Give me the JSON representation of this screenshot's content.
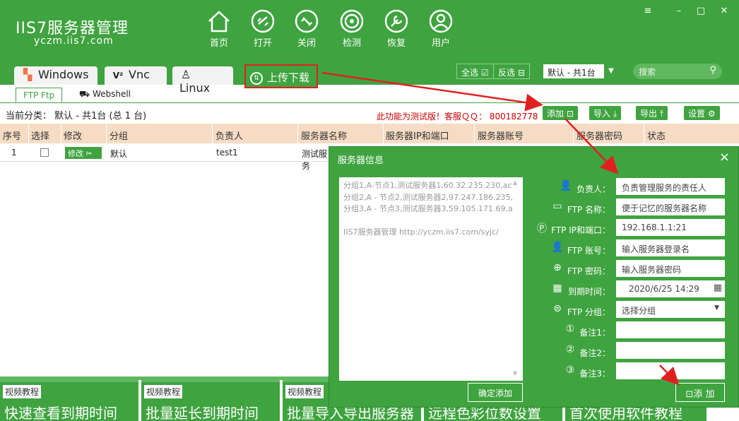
{
  "app": {
    "title": "IIS7服务器管理",
    "url": "yczm.iis7.com"
  },
  "nav": [
    {
      "label": "首页",
      "icon": "home-icon"
    },
    {
      "label": "打开",
      "icon": "link-icon"
    },
    {
      "label": "关闭",
      "icon": "unlink-icon"
    },
    {
      "label": "检测",
      "icon": "target-icon"
    },
    {
      "label": "恢复",
      "icon": "wrench-icon"
    },
    {
      "label": "用户",
      "icon": "user-icon"
    }
  ],
  "window_controls": {
    "menu": "≡",
    "minimize": "–",
    "maximize": "□",
    "close": "✕"
  },
  "tabs": [
    {
      "label": "Windows",
      "icon": "windows-icon"
    },
    {
      "label": "Vnc",
      "icon": "vnc-icon"
    },
    {
      "label": "Linux",
      "icon": "linux-icon"
    },
    {
      "label": "上传下载",
      "icon": "upload-download-icon"
    }
  ],
  "toolbar": {
    "select_all": "全选",
    "invert": "反选",
    "group_value": "默认 - 共1台",
    "search_placeholder": "搜索"
  },
  "subtabs": [
    {
      "label": "FTP  Ftp"
    },
    {
      "label": "Webshell"
    }
  ],
  "status": {
    "current_category": "当前分类： 默认 - 共1台 (总 1 台)",
    "notice": "此功能为测试版！客服ＱＱ： 800182778"
  },
  "actions": {
    "add": "添加",
    "import": "导入",
    "export": "导出",
    "settings": "设置"
  },
  "table": {
    "headers": [
      "序号",
      "选择",
      "修改",
      "分组",
      "负责人",
      "服务器名称",
      "服务器IP和端口",
      "服务器账号",
      "服务器密码",
      "状态"
    ],
    "rows": [
      {
        "index": "1",
        "modify": "修改",
        "group": "默认",
        "owner": "test1",
        "name": "测试服务"
      }
    ]
  },
  "dialog": {
    "title": "服务器信息",
    "close": "×",
    "textarea_lines": [
      "分组1,A-节点1,测试服务器1,60.32.235.230,ac",
      "分组2,A - 节点2,测试服务器2,97.247.186.235,",
      "分组3,A - 节点3,测试服务器3,59.105.171.69,a",
      "",
      "IIS7服务器管理  http://yczm.iis7.com/syjc/"
    ],
    "fields": [
      {
        "label": "负责人：",
        "value": "负责管理服务的责任人",
        "icon": "person-icon"
      },
      {
        "label": "FTP 名称：",
        "value": "便于记忆的服务器名称",
        "icon": "id-card-icon"
      },
      {
        "label": "FTP  IP和端口：",
        "value": "192.168.1.1:21",
        "icon": "ip-icon"
      },
      {
        "label": "FTP 账号：",
        "value": "输入服务器登录名",
        "icon": "person-icon"
      },
      {
        "label": "FTP 密码：",
        "value": "输入服务器密码",
        "icon": "lock-icon"
      },
      {
        "label": "到期时间：",
        "value": "2020/6/25 14:29",
        "icon": "calendar-icon"
      },
      {
        "label": "FTP 分组：",
        "value": "选择分组",
        "icon": "group-icon"
      },
      {
        "label": "备注1：",
        "value": "",
        "icon": "one-icon"
      },
      {
        "label": "备注2：",
        "value": "",
        "icon": "two-icon"
      },
      {
        "label": "备注3：",
        "value": "",
        "icon": "three-icon"
      }
    ],
    "confirm": "确定添加",
    "add": "添 加"
  },
  "video_cards": [
    {
      "tag": "视频教程",
      "title": "快速查看到期时间"
    },
    {
      "tag": "视频教程",
      "title": "批量延长到期时间"
    },
    {
      "tag": "视频教程",
      "title": "批量导入导出服务器"
    },
    {
      "tag": "",
      "title": "远程色彩位数设置"
    },
    {
      "tag": "",
      "title": "首次使用软件教程"
    }
  ],
  "colors": {
    "primary": "#3fa33f",
    "header_row": "#f6dcc4",
    "notice": "#cc0000",
    "arrow": "#e02020"
  }
}
